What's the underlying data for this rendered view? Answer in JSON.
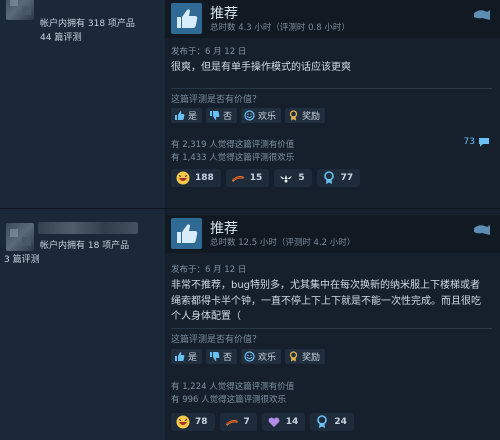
{
  "reviews": [
    {
      "owns": "帐户内拥有 318 项产品",
      "review_count": "44 篇评测",
      "verdict": "推荐",
      "hours": "总时数 4.3 小时（评测时 0.8 小时）",
      "posted": "发布于：6 月 12 日",
      "text": "很爽，但是有单手操作模式的话应该更爽",
      "helpful_prompt": "这篇评测是否有价值？",
      "buttons": {
        "yes": "是",
        "no": "否",
        "funny": "欢乐",
        "award": "奖励"
      },
      "helpful_stat": "有 2,319 人觉得这篇评测有价值",
      "funny_stat": "有 1,433 人觉得这篇评测很欢乐",
      "comments": "73",
      "awards": [
        {
          "icon": "laughing-face-icon",
          "count": "188"
        },
        {
          "icon": "hot-dog-icon",
          "count": "15"
        },
        {
          "icon": "winged-icon",
          "count": "5"
        },
        {
          "icon": "medal-icon",
          "count": "77"
        }
      ]
    },
    {
      "owns": "帐户内拥有 18 项产品",
      "review_count": "3 篇评测",
      "verdict": "推荐",
      "hours": "总时数 12.5 小时（评测时 4.2 小时）",
      "posted": "发布于：6 月 12 日",
      "text": "非常不推荐，bug特别多，尤其集中在每次换新的纳米服上下楼梯或者绳索都得卡半个钟，一直不停上下上下就是不能一次性完成。而且很吃个人身体配置（",
      "helpful_prompt": "这篇评测是否有价值？",
      "buttons": {
        "yes": "是",
        "no": "否",
        "funny": "欢乐",
        "award": "奖励"
      },
      "helpful_stat": "有 1,224 人觉得这篇评测有价值",
      "funny_stat": "有 996 人觉得这篇评测很欢乐",
      "awards": [
        {
          "icon": "laughing-face-icon",
          "count": "78"
        },
        {
          "icon": "hot-dog-icon",
          "count": "7"
        },
        {
          "icon": "heart-hands-icon",
          "count": "14"
        },
        {
          "icon": "medal-icon",
          "count": "24"
        }
      ]
    }
  ],
  "colors": {
    "background": "#1b2838",
    "card": "#16202d",
    "accent_blue": "#67c1f5",
    "thumb_blue": "#4a9fd6"
  }
}
